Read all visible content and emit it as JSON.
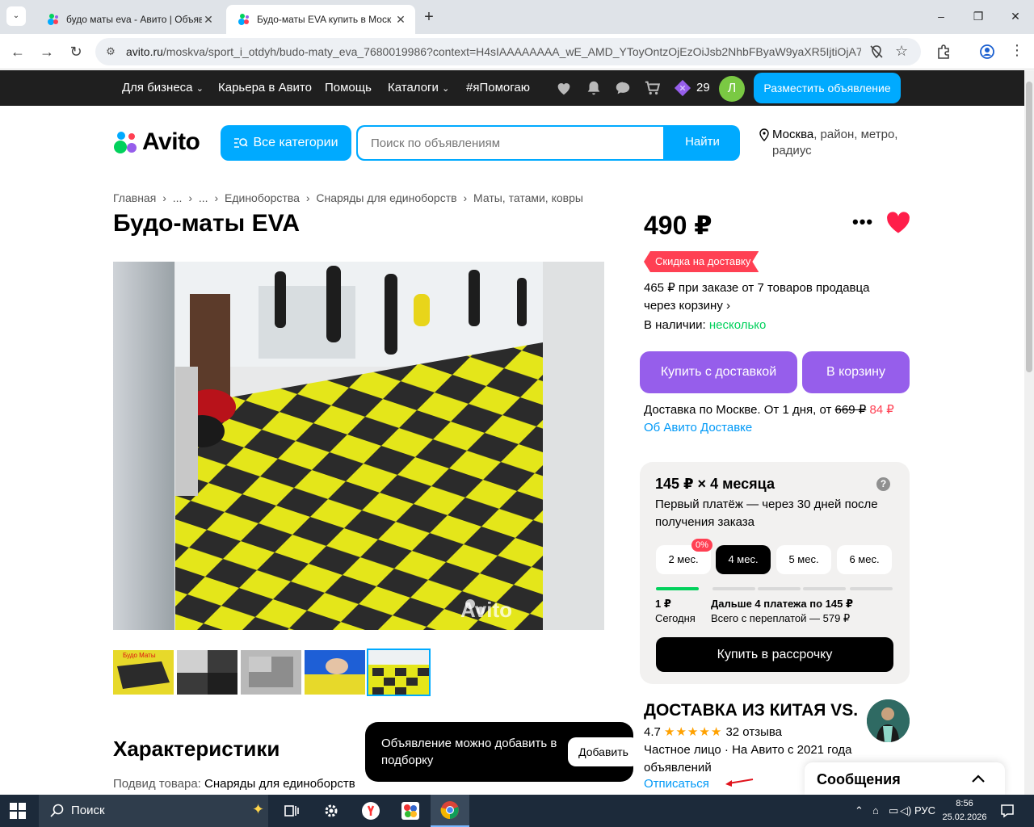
{
  "browser": {
    "tabs": [
      {
        "title": "будо маты eva - Авито | Объяв",
        "active": false
      },
      {
        "title": "Будо-маты EVA купить в Моск",
        "active": true
      }
    ],
    "new_tab": "+",
    "url_host": "avito.ru",
    "url_rest": "/moskva/sport_i_otdyh/budo-maty_eva_7680019986?context=H4sIAAAAAAAA_wE_AMD_YToyOntzOjEzOiJsb2NhbFByaW9yaXR5IjtiOjA7czo...",
    "controls": {
      "minimize": "–",
      "maximize": "❐",
      "close": "✕"
    }
  },
  "topnav": {
    "items": [
      "Для бизнеса",
      "Карьера в Авито",
      "Помощь",
      "Каталоги",
      "#яПомогаю"
    ],
    "bonus_count": "29",
    "avatar_letter": "Л",
    "post_button": "Разместить объявление"
  },
  "header": {
    "logo": "Avito",
    "categories_button": "Все категории",
    "search_placeholder": "Поиск по объявлениям",
    "search_button": "Найти",
    "location_city": "Москва",
    "location_rest_1": ", район, метро,",
    "location_rest_2": "радиус"
  },
  "breadcrumbs": [
    "Главная",
    "›",
    "...",
    "›",
    "...",
    "›",
    "Единоборства",
    "›",
    "Снаряды для единоборств",
    "›",
    "Маты, татами, ковры"
  ],
  "listing": {
    "title": "Будо-маты EVA",
    "watermark": "Avito",
    "thumb_label": "Будо Маты"
  },
  "characteristics": {
    "heading": "Характеристики",
    "rows": [
      {
        "label": "Подвид товара:",
        "value": "Снаряды для единоборств"
      }
    ]
  },
  "purchase": {
    "price": "490 ₽",
    "more": "•••",
    "discount_badge": "Скидка на доставку",
    "bulk_line1": "465 ₽ при заказе от 7 товаров продавца",
    "bulk_line2": "через корзину ›",
    "stock_label": "В наличии:",
    "stock_value": "несколько",
    "buy_button": "Купить с доставкой",
    "cart_button": "В корзину",
    "delivery_text": "Доставка по Москве. От 1 дня, от",
    "delivery_old": "669 ₽",
    "delivery_new": "84 ₽",
    "delivery_link": "Об Авито Доставке"
  },
  "installments": {
    "headline": "145 ₽ × 4 месяца",
    "help": "?",
    "subtitle": "Первый платёж — через 30 дней после получения заказа",
    "terms": [
      "2 мес.",
      "4 мес.",
      "5 мес.",
      "6 мес."
    ],
    "selected_term": "4 мес.",
    "zero_badge": "0%",
    "first_amount": "1 ₽",
    "first_when": "Сегодня",
    "rest_title": "Дальше 4 платежа по 145 ₽",
    "rest_total": "Всего с переплатой — 579 ₽",
    "button": "Купить в рассрочку",
    "progress_filled": 1,
    "progress_total": 5
  },
  "seller": {
    "name": "ДОСТАВКА ИЗ КИТАЯ VS.",
    "rating_value": "4.7",
    "stars": "★★★★★",
    "reviews": "32 отзыва",
    "info": "Частное лицо · На Авито с 2021 года",
    "ads": "объявлений",
    "unsubscribe": "Отписаться"
  },
  "toast": {
    "text": "Объявление можно добавить в подборку",
    "button": "Добавить"
  },
  "messages": {
    "title": "Сообщения"
  },
  "taskbar": {
    "search_label": "Поиск",
    "lang": "РУС",
    "time": "8:56",
    "date": "25.02.2026"
  },
  "colors": {
    "avito_blue": "#00aaff",
    "purple": "#965eeb",
    "red": "#ff4053",
    "green": "#02d15c",
    "topnav_bg": "#1f1f1f"
  }
}
